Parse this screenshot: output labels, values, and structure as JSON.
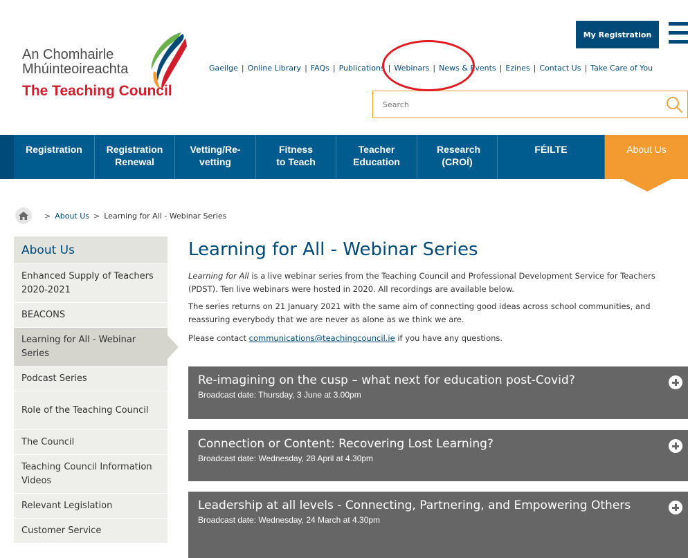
{
  "header": {
    "logo": {
      "line1": "An Chomhairle",
      "line2": "Mhúinteoireachta",
      "line3": "The Teaching Council"
    },
    "my_registration_label": "My Registration",
    "menu_icon": "hamburger-icon",
    "top_links": [
      "Gaeilge",
      "Online Library",
      "FAQs",
      "Publications",
      "Webinars",
      "News & Events",
      "Ezines",
      "Contact Us",
      "Take Care of You"
    ],
    "search": {
      "placeholder": "Search",
      "icon": "search-icon"
    }
  },
  "nav": {
    "items": [
      {
        "label": "Registration",
        "active": false
      },
      {
        "label": "Registration Renewal",
        "active": false
      },
      {
        "label": "Vetting/Re-vetting",
        "active": false
      },
      {
        "label": "Fitness to Teach",
        "active": false
      },
      {
        "label": "Teacher Education",
        "active": false
      },
      {
        "label": "Research (CROÍ)",
        "active": false
      },
      {
        "label": "FÉILTE",
        "active": false
      },
      {
        "label": "About Us",
        "active": true
      }
    ]
  },
  "breadcrumb": {
    "home_icon": "home-icon",
    "items": [
      "About Us",
      "Learning for All - Webinar Series"
    ]
  },
  "sidebar": {
    "heading": "About Us",
    "items": [
      {
        "label": "Enhanced Supply of Teachers 2020-2021",
        "active": false
      },
      {
        "label": "BEACONS",
        "active": false
      },
      {
        "label": "Learning for All - Webinar Series",
        "active": true
      },
      {
        "label": "Podcast Series",
        "active": false
      },
      {
        "label": "Role of the Teaching Council",
        "active": false
      },
      {
        "label": "The Council",
        "active": false
      },
      {
        "label": "Teaching Council Information Videos",
        "active": false
      },
      {
        "label": "Relevant Legislation",
        "active": false
      },
      {
        "label": "Customer Service",
        "active": false
      }
    ]
  },
  "main": {
    "title": "Learning for All - Webinar Series",
    "intro_italic": "Learning for All",
    "intro_rest": " is a live webinar series from the Teaching Council and Professional Development Service for Teachers (PDST). Ten live webinars were hosted in 2020. All recordings are available below.",
    "para2": "The series returns on 21 January 2021 with the same aim of connecting good ideas across school communities, and reassuring everybody that we are never as alone as we think we are.",
    "para3_before": "Please contact ",
    "para3_link": "communications@teachingcouncil.ie",
    "para3_after": " if you have any questions.",
    "webinars": [
      {
        "title": "Re-imagining on the cusp – what next for education post-Covid?",
        "date": "Broadcast date: Thursday, 3 June at 3.00pm"
      },
      {
        "title": "Connection or Content: Recovering Lost Learning?",
        "date": "Broadcast date: Wednesday, 28 April at 4.30pm"
      },
      {
        "title": "Leadership at all levels - Connecting, Partnering, and Empowering Others",
        "date": "Broadcast date: Wednesday, 24 March at 4.30pm"
      }
    ]
  },
  "colors": {
    "brand_blue": "#004a79",
    "nav_blue": "#005b8e",
    "accent_orange": "#f39a31",
    "logo_red": "#cf1f2c",
    "annotation_red": "#e01b24",
    "webinar_grey": "#666666"
  }
}
